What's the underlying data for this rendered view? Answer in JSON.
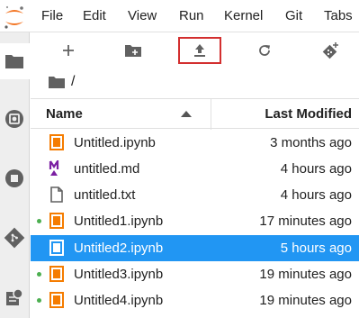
{
  "menu": {
    "items": [
      {
        "label": "File"
      },
      {
        "label": "Edit"
      },
      {
        "label": "View"
      },
      {
        "label": "Run"
      },
      {
        "label": "Kernel"
      },
      {
        "label": "Git"
      },
      {
        "label": "Tabs"
      }
    ]
  },
  "sidebar": {
    "icons": [
      "folder-icon",
      "running-kernels-icon",
      "stop-circle-icon",
      "git-icon",
      "extension-manager-icon"
    ]
  },
  "toolbar": {
    "buttons": [
      "new-launcher-icon",
      "new-folder-icon",
      "upload-icon",
      "refresh-icon",
      "git-clone-icon"
    ],
    "highlighted": "upload-icon"
  },
  "breadcrumb": {
    "path": "/"
  },
  "table": {
    "name_header": "Name",
    "modified_header": "Last Modified",
    "sort": "ascending"
  },
  "files": [
    {
      "name": "Untitled.ipynb",
      "modified": "3 months ago",
      "type": "notebook",
      "running": false,
      "selected": false
    },
    {
      "name": "untitled.md",
      "modified": "4 hours ago",
      "type": "markdown",
      "running": false,
      "selected": false
    },
    {
      "name": "untitled.txt",
      "modified": "4 hours ago",
      "type": "text",
      "running": false,
      "selected": false
    },
    {
      "name": "Untitled1.ipynb",
      "modified": "17 minutes ago",
      "type": "notebook",
      "running": true,
      "selected": false
    },
    {
      "name": "Untitled2.ipynb",
      "modified": "5 hours ago",
      "type": "notebook",
      "running": false,
      "selected": true
    },
    {
      "name": "Untitled3.ipynb",
      "modified": "19 minutes ago",
      "type": "notebook",
      "running": true,
      "selected": false
    },
    {
      "name": "Untitled4.ipynb",
      "modified": "19 minutes ago",
      "type": "notebook",
      "running": true,
      "selected": false
    }
  ],
  "colors": {
    "selection": "#2196f3",
    "running": "#4caf50",
    "notebook": "#f57c00",
    "markdown": "#7b1fa2",
    "highlight_border": "#d32f2f"
  }
}
